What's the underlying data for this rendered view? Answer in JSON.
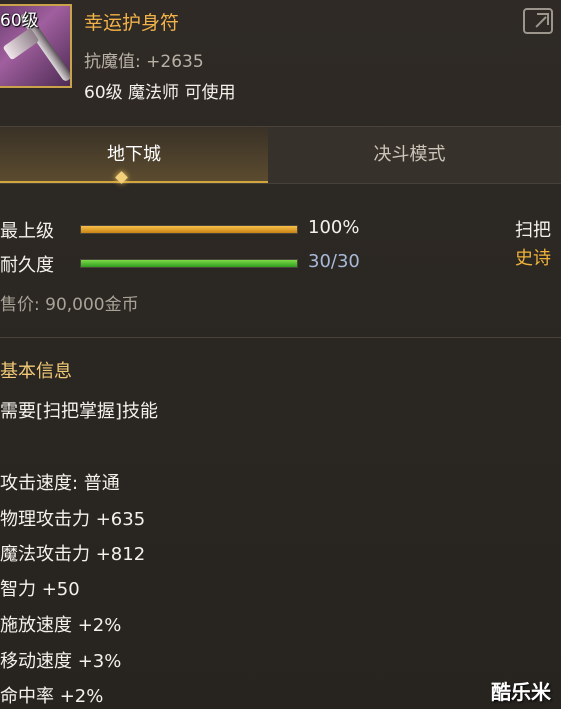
{
  "item": {
    "level_badge": "60级",
    "name": "幸运护身符",
    "stat_line": "抗魔值: +2635",
    "requirement": "60级 魔法师 可使用"
  },
  "tabs": [
    {
      "label": "地下城",
      "active": true
    },
    {
      "label": "决斗模式",
      "active": false
    }
  ],
  "bars": {
    "grade": {
      "label": "最上级",
      "value_text": "100%",
      "fill": 1.0
    },
    "durability": {
      "label": "耐久度",
      "value_text": "30/30",
      "fill": 1.0
    }
  },
  "type": {
    "weapon": "扫把",
    "rarity": "史诗"
  },
  "price": "售价: 90,000金币",
  "section": {
    "title": "基本信息"
  },
  "info_lines": [
    "需要[扫把掌握]技能",
    "攻击速度: 普通",
    "物理攻击力 +635",
    "魔法攻击力 +812",
    "智力 +50",
    "施放速度 +2%",
    "移动速度 +3%",
    "命中率 +2%"
  ],
  "watermark": "酷乐米",
  "colors": {
    "name_orange": "#f2b24a",
    "rarity_epic": "#f0b23a",
    "value_blue": "#a8b9d8",
    "accent_gold": "#d4a43f"
  }
}
